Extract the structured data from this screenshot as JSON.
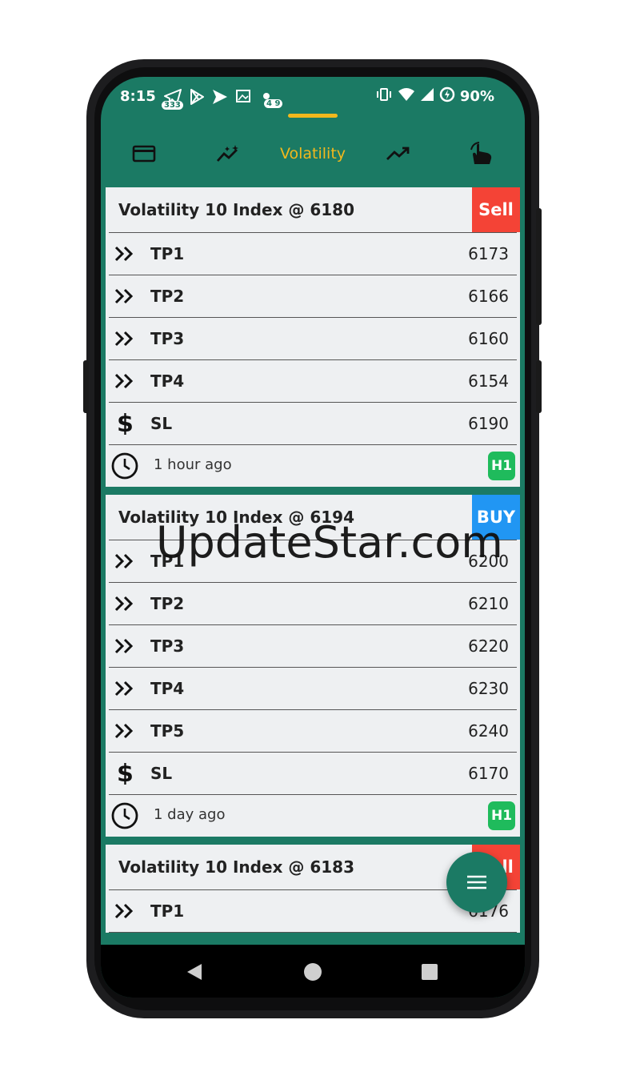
{
  "status_bar": {
    "time": "8:15",
    "notif_badge_1": "333",
    "notif_badge_2": "4 9",
    "battery": "90%"
  },
  "tabs": [
    {
      "name": "card-icon"
    },
    {
      "name": "chart-sparkle-icon"
    },
    {
      "label": "Volatility",
      "active": true
    },
    {
      "name": "trending-up-icon"
    },
    {
      "name": "hand-pointer-icon"
    }
  ],
  "colors": {
    "primary": "#1b7a64",
    "accent": "#f2b81d",
    "sell": "#f44336",
    "buy": "#2196f3",
    "timeframe": "#1fbb5c"
  },
  "signals": [
    {
      "title": "Volatility 10 Index @ 6180",
      "action": "Sell",
      "rows": [
        {
          "label": "TP1",
          "value": "6173"
        },
        {
          "label": "TP2",
          "value": "6166"
        },
        {
          "label": "TP3",
          "value": "6160"
        },
        {
          "label": "TP4",
          "value": "6154"
        }
      ],
      "sl": {
        "label": "SL",
        "value": "6190"
      },
      "time": "1 hour ago",
      "timeframe": "H1"
    },
    {
      "title": "Volatility 10 Index @ 6194",
      "action": "BUY",
      "rows": [
        {
          "label": "TP1",
          "value": "6200"
        },
        {
          "label": "TP2",
          "value": "6210"
        },
        {
          "label": "TP3",
          "value": "6220"
        },
        {
          "label": "TP4",
          "value": "6230"
        },
        {
          "label": "TP5",
          "value": "6240"
        }
      ],
      "sl": {
        "label": "SL",
        "value": "6170"
      },
      "time": "1 day ago",
      "timeframe": "H1"
    },
    {
      "title": "Volatility 10 Index @ 6183",
      "action": "Sell",
      "rows": [
        {
          "label": "TP1",
          "value": "6176"
        }
      ]
    }
  ],
  "watermark": "UpdateStar.com"
}
